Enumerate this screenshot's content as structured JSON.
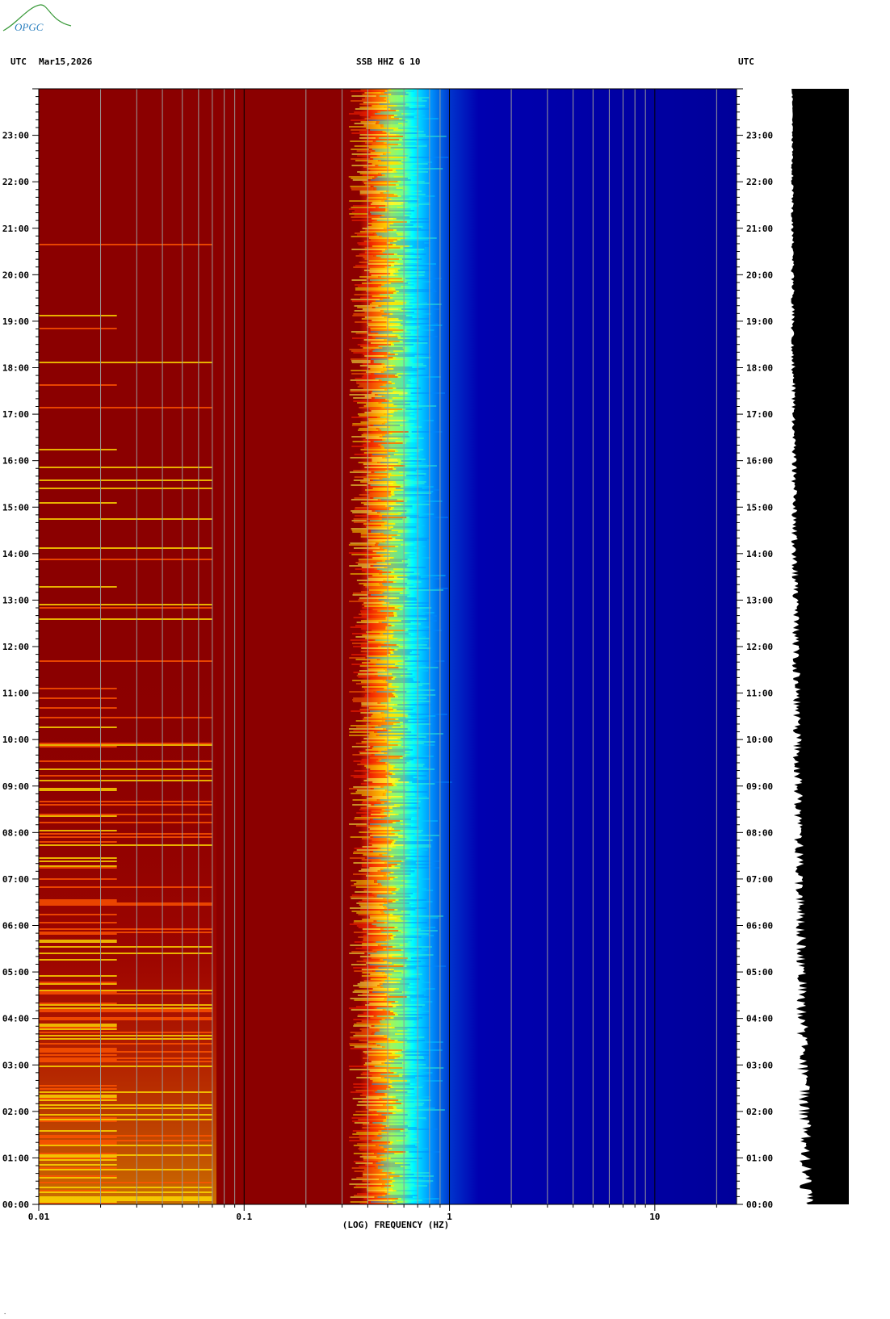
{
  "header": {
    "left_label": "UTC",
    "date": "Mar15,2026",
    "station": "SSB HHZ G 10",
    "right_label": "UTC"
  },
  "logo": {
    "text": "OPGC",
    "color": "#2a7fbf",
    "accent": "#3a9a3a"
  },
  "chart_data": {
    "type": "heatmap",
    "title": "SSB HHZ G 10",
    "xlabel": "(LOG) FREQUENCY (HZ)",
    "ylabel": "",
    "x_scale": "log",
    "xlim": [
      0.01,
      25
    ],
    "x_ticks": [
      {
        "value": 0.01,
        "label": "0.01"
      },
      {
        "value": 0.1,
        "label": "0.1"
      },
      {
        "value": 1,
        "label": "1"
      },
      {
        "value": 10,
        "label": "10"
      }
    ],
    "x_gridlines": [
      0.02,
      0.03,
      0.04,
      0.05,
      0.06,
      0.07,
      0.08,
      0.09,
      0.2,
      0.3,
      0.4,
      0.5,
      0.6,
      0.7,
      0.8,
      0.9,
      2,
      3,
      4,
      5,
      6,
      7,
      8,
      9,
      20
    ],
    "ylim": [
      "00:00",
      "24:00"
    ],
    "y_ticks": [
      "00:00",
      "01:00",
      "02:00",
      "03:00",
      "04:00",
      "05:00",
      "06:00",
      "07:00",
      "08:00",
      "09:00",
      "10:00",
      "11:00",
      "12:00",
      "13:00",
      "14:00",
      "15:00",
      "16:00",
      "17:00",
      "18:00",
      "19:00",
      "20:00",
      "21:00",
      "22:00",
      "23:00"
    ],
    "colormap": [
      "#00008b",
      "#0033cc",
      "#00aaff",
      "#00ffff",
      "#ffff00",
      "#ff8800",
      "#ff0000",
      "#8b0000"
    ],
    "bands": [
      {
        "f_low": 0.01,
        "f_high": 0.3,
        "level": "high",
        "color": "#8b0000"
      },
      {
        "f_low": 0.3,
        "f_high": 0.9,
        "level": "transition",
        "color": "#ffcc00"
      },
      {
        "f_low": 0.9,
        "f_high": 25,
        "level": "low",
        "color": "#0000a8"
      }
    ],
    "grid": true,
    "trace_panel": "amplitude trace (black) alongside time axis"
  }
}
